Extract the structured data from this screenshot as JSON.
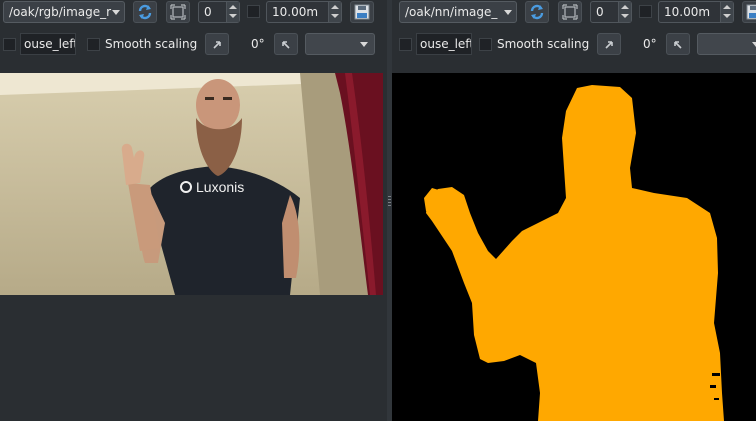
{
  "left_panel": {
    "topic": "/oak/rgb/image_r",
    "offset_value": "0",
    "max_value": "10.00m",
    "mouse_label": "ouse_left",
    "smooth_scaling_label": "Smooth scaling",
    "rotation": "0°",
    "shirt_text": "Luxonis"
  },
  "right_panel": {
    "topic": "/oak/nn/image_",
    "offset_value": "0",
    "max_value": "10.00m",
    "mouse_label": "ouse_left",
    "smooth_scaling_label": "Smooth scaling",
    "rotation": "0°"
  },
  "colors": {
    "background": "#2a2e32",
    "mask_color": "#ffa800",
    "mask_background": "#000000",
    "refresh_icon": "#3b8fd4"
  },
  "icons": [
    "refresh-icon",
    "zoom-fit-icon",
    "save-image-icon",
    "rotate-left-icon",
    "rotate-right-icon",
    "chevron-down-icon",
    "spin-up-icon",
    "spin-down-icon"
  ]
}
